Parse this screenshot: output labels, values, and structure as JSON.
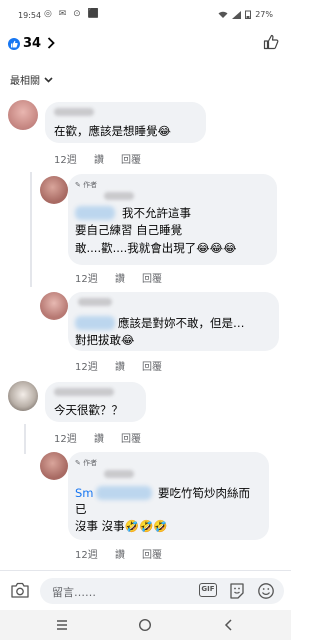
{
  "status_bar": {
    "time": "19:54",
    "battery": "27%"
  },
  "header": {
    "like_count": "34"
  },
  "sort": {
    "label": "最相關"
  },
  "comments": [
    {
      "text": "在歡，應該是想睡覺😂",
      "age": "12週",
      "like": "讚",
      "reply": "回覆"
    },
    {
      "author_tag": "作者",
      "lines": [
        "我不允許這事",
        "要自己練習 自己睡覺",
        "敢....歡....我就會出現了😂😂😂"
      ],
      "age": "12週",
      "like": "讚",
      "reply": "回覆"
    },
    {
      "lines": [
        "應該是對妳不敢，但是…",
        "對把拔敢😂"
      ],
      "age": "12週",
      "like": "讚",
      "reply": "回覆"
    },
    {
      "text": "今天很歡？？",
      "age": "12週",
      "like": "讚",
      "reply": "回覆"
    },
    {
      "author_tag": "作者",
      "mention_prefix": "Sm",
      "lines": [
        "要吃竹筍炒肉絲而",
        "已",
        "沒事 沒事🤣🤣🤣"
      ],
      "age": "12週",
      "like": "讚",
      "reply": "回覆"
    }
  ],
  "composer": {
    "placeholder": "留言……"
  },
  "colors": {
    "accent": "#1877f2",
    "bubble": "#f0f2f5",
    "secondary_text": "#65676b"
  }
}
